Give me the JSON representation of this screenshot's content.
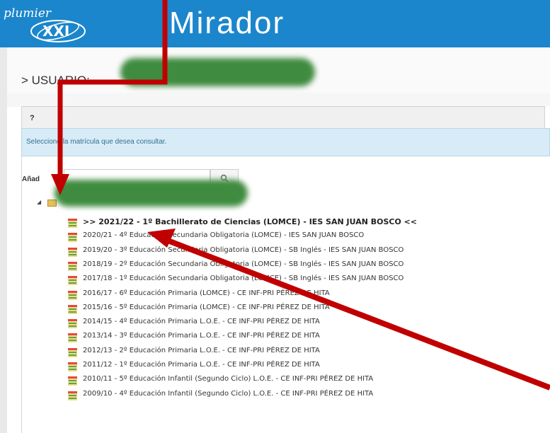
{
  "header": {
    "logo_text": "plumier",
    "logo_sub": "XXI",
    "title": "Mirador"
  },
  "user": {
    "label": "> USUARIO:"
  },
  "panel": {
    "tab_label": "?",
    "info_message": "Seleccione la matrícula que desea consultar.",
    "year_label": "Añad",
    "year_placeholder": ""
  },
  "tree": {
    "items": [
      {
        "label": ">> 2021/22 - 1º Bachillerato de Ciencias (LOMCE) - IES SAN JUAN BOSCO <<",
        "selected": true
      },
      {
        "label": "2020/21 - 4º Educación Secundaria Obligatoria (LOMCE) - IES SAN JUAN BOSCO"
      },
      {
        "label": "2019/20 - 3º Educación Secundaria Obligatoria (LOMCE) - SB Inglés - IES SAN JUAN BOSCO"
      },
      {
        "label": "2018/19 - 2º Educación Secundaria Obligatoria (LOMCE) - SB Inglés - IES SAN JUAN BOSCO"
      },
      {
        "label": "2017/18 - 1º Educación Secundaria Obligatoria (LOMCE) - SB Inglés - IES SAN JUAN BOSCO"
      },
      {
        "label": "2016/17 - 6º Educación Primaria (LOMCE) - CE INF-PRI PÉREZ DE HITA"
      },
      {
        "label": "2015/16 - 5º Educación Primaria (LOMCE) - CE INF-PRI PÉREZ DE HITA"
      },
      {
        "label": "2014/15 - 4º Educación Primaria L.O.E. - CE INF-PRI PÉREZ DE HITA"
      },
      {
        "label": "2013/14 - 3º Educación Primaria L.O.E. - CE INF-PRI PÉREZ DE HITA"
      },
      {
        "label": "2012/13 - 2º Educación Primaria L.O.E. - CE INF-PRI PÉREZ DE HITA"
      },
      {
        "label": "2011/12 - 1º Educación Primaria L.O.E. - CE INF-PRI PÉREZ DE HITA"
      },
      {
        "label": "2010/11 - 5º Educación Infantil (Segundo Ciclo) L.O.E. - CE INF-PRI PÉREZ DE HITA"
      },
      {
        "label": "2009/10 - 4º Educación Infantil (Segundo Ciclo) L.O.E. - CE INF-PRI PÉREZ DE HITA"
      }
    ]
  },
  "colors": {
    "header": "#1b86cc",
    "info_bg": "#d8ecf8",
    "annotation_arrow": "#c00000"
  }
}
